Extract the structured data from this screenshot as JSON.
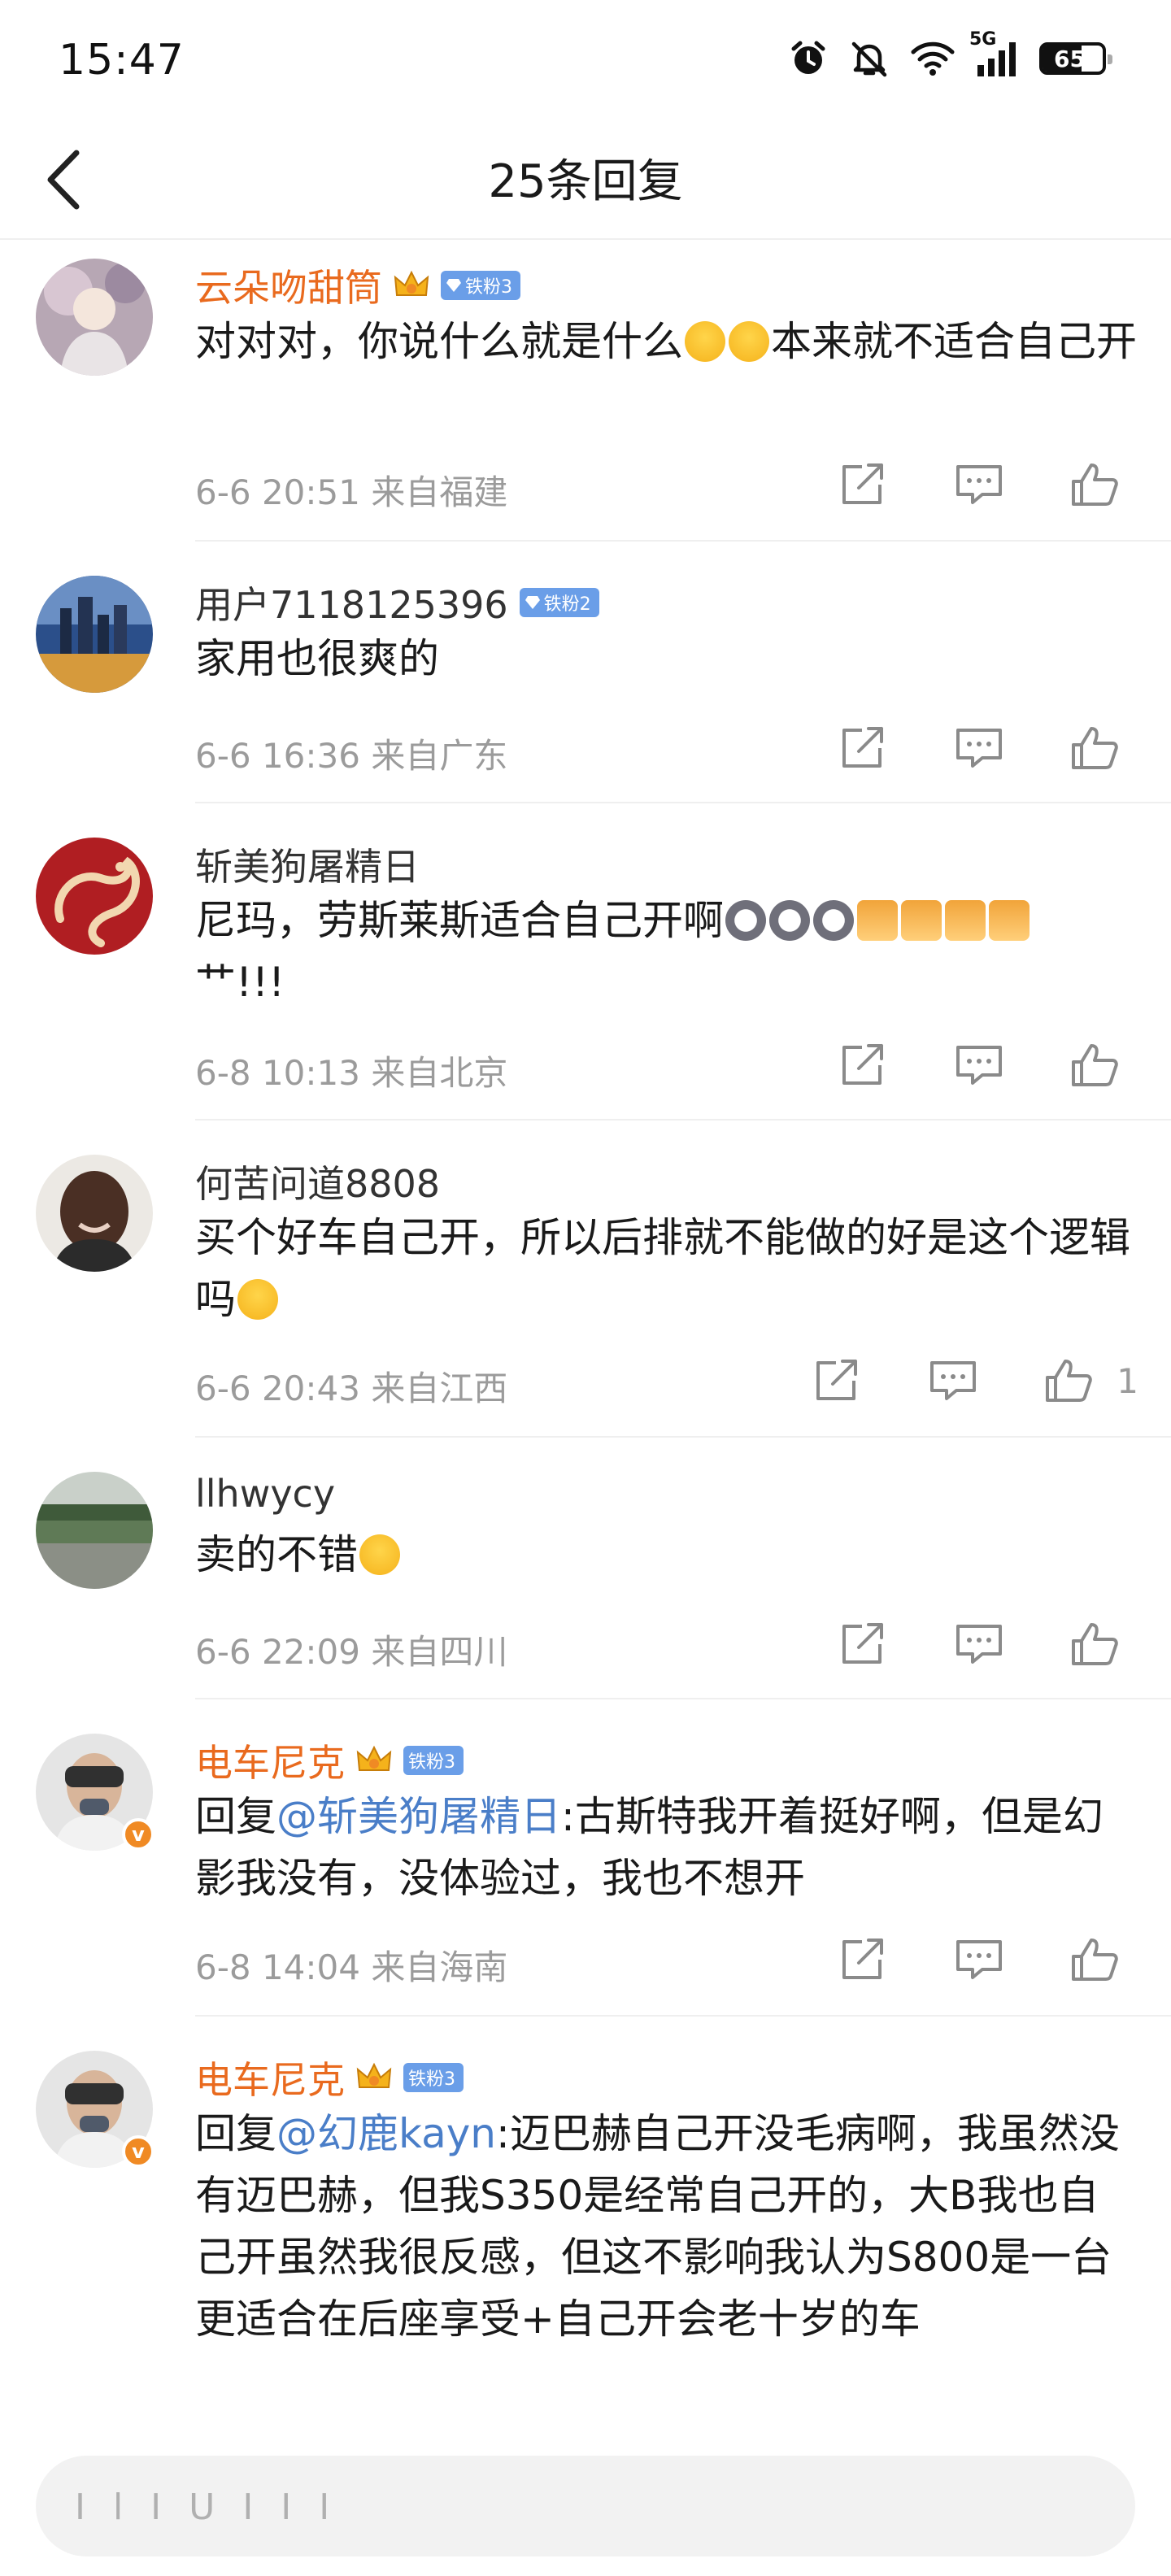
{
  "status": {
    "time": "15:47",
    "network": "5G",
    "battery": "65",
    "battery_level": 0.65
  },
  "header": {
    "title": "25条回复"
  },
  "comments": [
    {
      "username": "云朵吻甜筒",
      "badge": "铁粉3",
      "text_before": "对对对，你说什么就是什么",
      "emojis": [
        "laugh",
        "laugh"
      ],
      "text_after": "本来就不适合自己开",
      "meta": "6-6 20:51 来自福建",
      "likes": ""
    },
    {
      "username": "用户7118125396",
      "badge": "铁粉2",
      "text": "家用也很爽的",
      "meta": "6-6 16:36 来自广东",
      "likes": ""
    },
    {
      "username": "斩美狗屠精日",
      "badge": "",
      "text_before": "尼玛，劳斯莱斯适合自己开啊",
      "emojis": [
        "dog",
        "dog",
        "dog",
        "thumb",
        "thumb",
        "thumb",
        "thumb"
      ],
      "text_after": "艹!!!",
      "meta": "6-8 10:13 来自北京",
      "likes": ""
    },
    {
      "username": "何苦问道8808",
      "badge": "",
      "text_before": "买个好车自己开，所以后排就不能做的好是这个逻辑吗",
      "emojis": [
        "laugh"
      ],
      "text_after": "",
      "meta": "6-6 20:43 来自江西",
      "likes": "1"
    },
    {
      "username": "llhwycy",
      "badge": "",
      "text_before": "卖的不错",
      "emojis": [
        "laugh"
      ],
      "text_after": "",
      "meta": "6-6 22:09 来自四川",
      "likes": ""
    },
    {
      "username": "电车尼克",
      "badge": "铁粉3",
      "reply_prefix": "回复",
      "mention": "@斩美狗屠精日",
      "text": ":古斯特我开着挺好啊，但是幻影我没有，没体验过，我也不想开",
      "meta": "6-8 14:04 来自海南",
      "likes": ""
    },
    {
      "username": "电车尼克",
      "badge": "铁粉3",
      "reply_prefix": "回复",
      "mention": "@幻鹿kayn",
      "text": ":迈巴赫自己开没毛病啊，我虽然没有迈巴赫，但我S350是经常自己开的，大B我也自己开虽然我很反感，但这不影响我认为S800是一台更适合在后座享受+自己开会老十岁的车",
      "meta": "",
      "likes": ""
    }
  ],
  "reply_bar": {
    "placeholder": "I l I U  I I I"
  }
}
